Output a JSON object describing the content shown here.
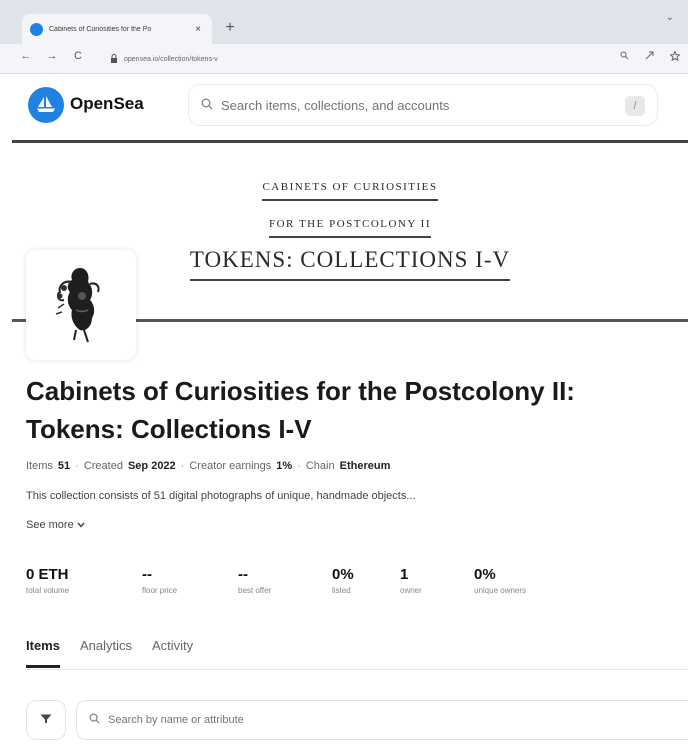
{
  "browser": {
    "tab_title": "Cabinets of Curiosities for the Po",
    "tab_close": "×",
    "new_tab": "+",
    "window_control": "⌄",
    "back": "←",
    "forward": "→",
    "reload": "C",
    "url": "opensea.io/collection/tokens-v",
    "favicon_color": "#2081e2"
  },
  "header": {
    "brand": "OpenSea",
    "search_placeholder": "Search items, collections, and accounts",
    "slash_key": "/",
    "brand_color": "#2081e2"
  },
  "banner": {
    "line1": "CABINETS OF CURIOSITIES",
    "line2": "FOR THE POSTCOLONY II",
    "line3": "TOKENS: COLLECTIONS I-V"
  },
  "collection": {
    "title": "Cabinets of Curiosities for the Postcolony II: Tokens: Collections I-V",
    "meta": {
      "items_label": "Items",
      "items_value": "51",
      "created_label": "Created",
      "created_value": "Sep 2022",
      "earnings_label": "Creator earnings",
      "earnings_value": "1%",
      "chain_label": "Chain",
      "chain_value": "Ethereum"
    },
    "description": "This collection consists of 51 digital photographs of unique, handmade objects...",
    "see_more": "See more"
  },
  "stats": [
    {
      "value": "0 ETH",
      "label": "total volume"
    },
    {
      "value": "--",
      "label": "floor price"
    },
    {
      "value": "--",
      "label": "best offer"
    },
    {
      "value": "0%",
      "label": "listed"
    },
    {
      "value": "1",
      "label": "owner"
    },
    {
      "value": "0%",
      "label": "unique owners"
    }
  ],
  "tabs": [
    "Items",
    "Analytics",
    "Activity"
  ],
  "filter": {
    "search_placeholder": "Search by name or attribute"
  }
}
